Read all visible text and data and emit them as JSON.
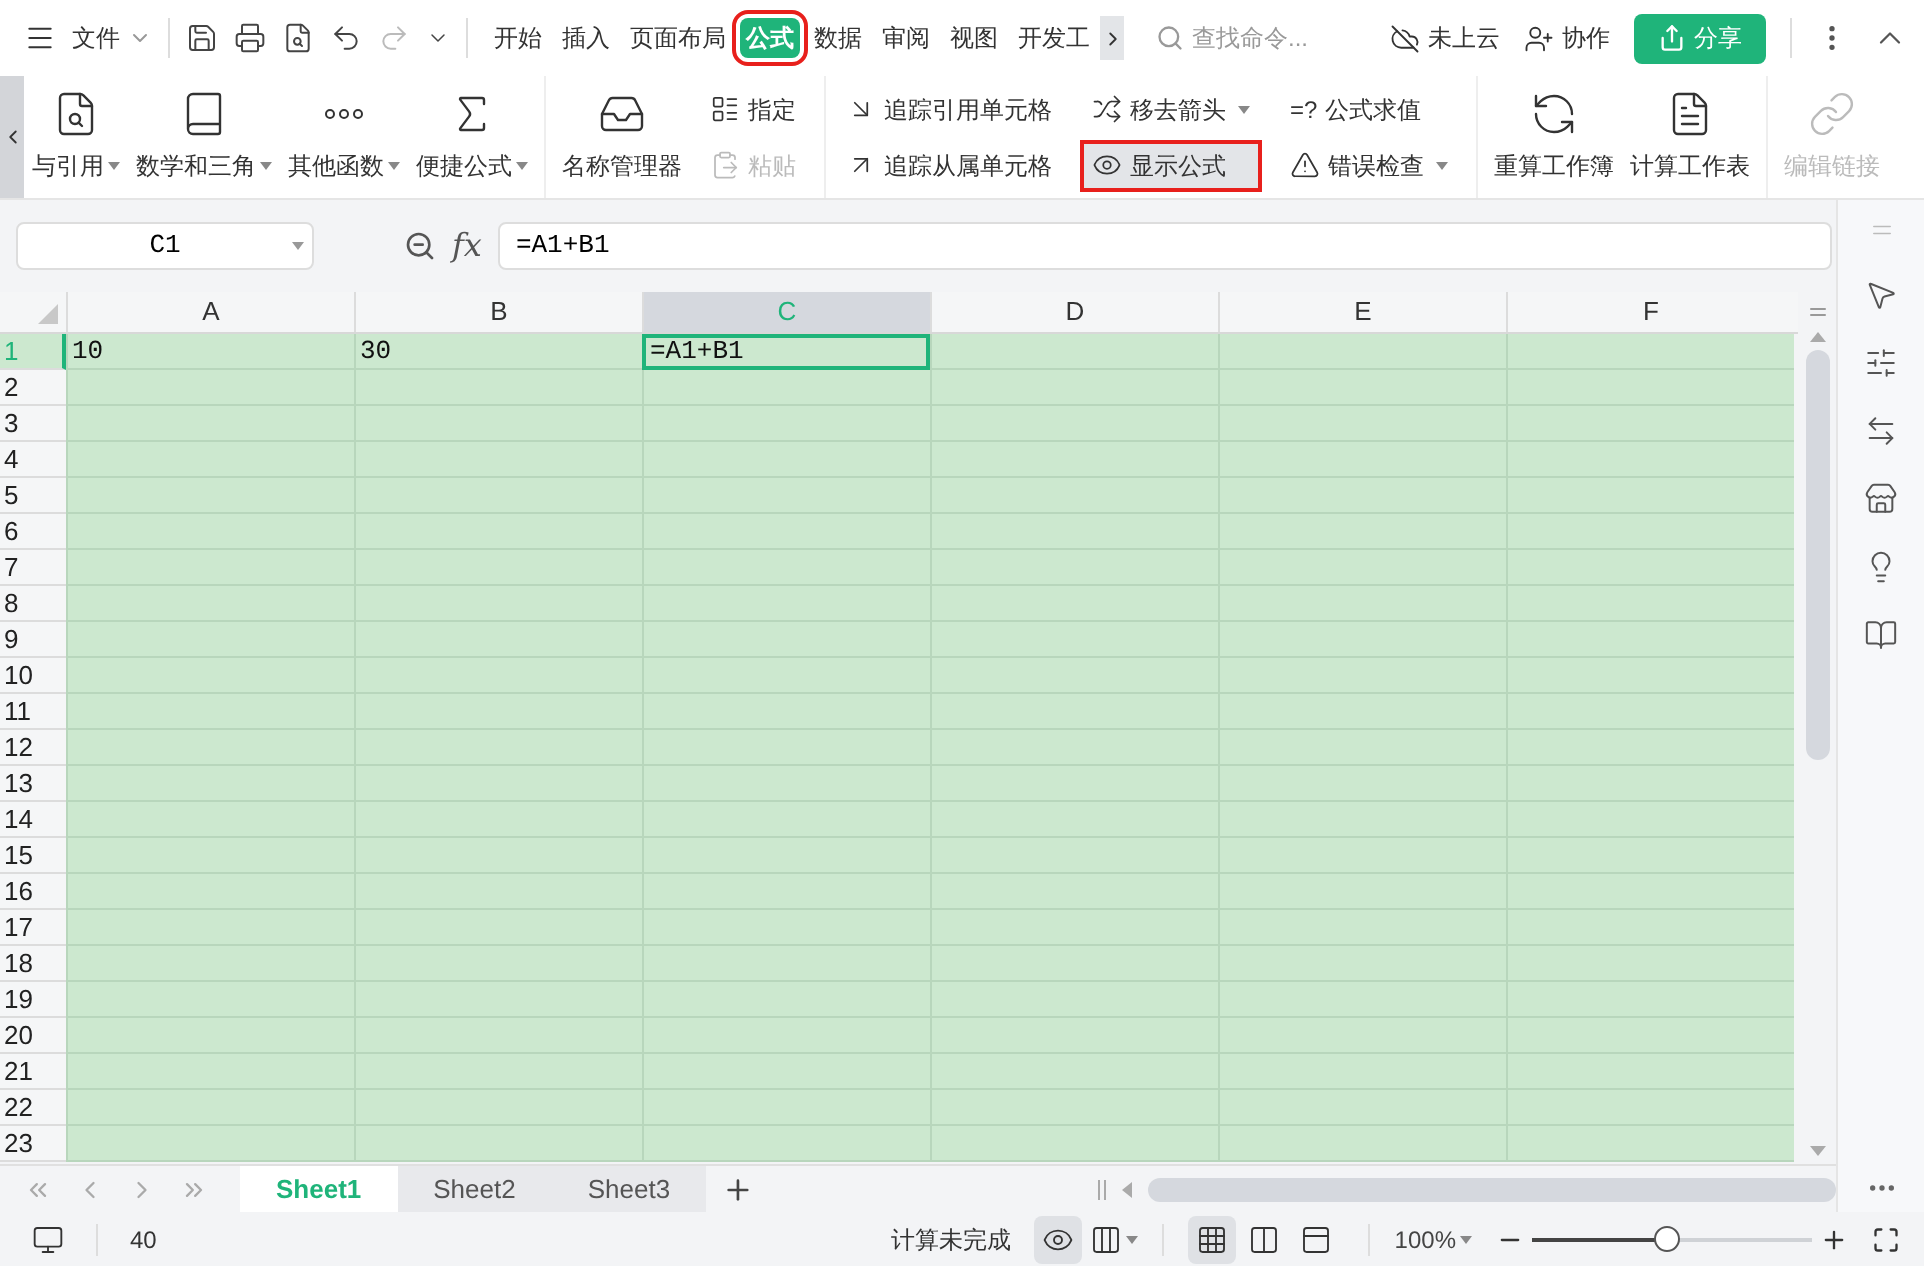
{
  "toolbar": {
    "menu": "文件",
    "tabs": [
      {
        "label": "开始",
        "selected": false,
        "highlighted": false
      },
      {
        "label": "插入",
        "selected": false,
        "highlighted": false
      },
      {
        "label": "页面布局",
        "selected": false,
        "highlighted": false
      },
      {
        "label": "公式",
        "selected": true,
        "highlighted": true
      },
      {
        "label": "数据",
        "selected": false,
        "highlighted": false
      },
      {
        "label": "审阅",
        "selected": false,
        "highlighted": false
      },
      {
        "label": "视图",
        "selected": false,
        "highlighted": false
      },
      {
        "label": "开发工",
        "selected": false,
        "highlighted": false
      }
    ],
    "search": {
      "placeholder": "查找命令..."
    },
    "cloud": "未上云",
    "collab": "协作",
    "share": "分享"
  },
  "ribbon": {
    "groups": [
      {
        "kind": "large",
        "items": [
          {
            "label": "与引用",
            "dropdown": true,
            "disabled": false
          },
          {
            "label": "数学和三角",
            "dropdown": true,
            "disabled": false
          },
          {
            "label": "其他函数",
            "dropdown": true,
            "disabled": false
          },
          {
            "label": "便捷公式",
            "dropdown": true,
            "disabled": false
          }
        ]
      },
      {
        "kind": "large",
        "items": [
          {
            "label": "名称管理器",
            "dropdown": false,
            "disabled": false
          }
        ]
      },
      {
        "kind": "small",
        "items": [
          {
            "label": "指定",
            "dropdown": false,
            "disabled": false,
            "selected": false,
            "highlighted": false
          },
          {
            "label": "粘贴",
            "dropdown": false,
            "disabled": true,
            "selected": false,
            "highlighted": false
          }
        ]
      },
      {
        "kind": "small",
        "items": [
          {
            "label": "追踪引用单元格",
            "dropdown": false,
            "disabled": false,
            "selected": false,
            "highlighted": false
          },
          {
            "label": "追踪从属单元格",
            "dropdown": false,
            "disabled": false,
            "selected": false,
            "highlighted": false
          }
        ]
      },
      {
        "kind": "small",
        "items": [
          {
            "label": "移去箭头",
            "dropdown": true,
            "disabled": false,
            "selected": false,
            "highlighted": false
          },
          {
            "label": "显示公式",
            "dropdown": false,
            "disabled": false,
            "selected": true,
            "highlighted": true
          }
        ]
      },
      {
        "kind": "small",
        "items": [
          {
            "label": "公式求值",
            "icon_text": "=?",
            "dropdown": false,
            "disabled": false,
            "selected": false,
            "highlighted": false
          },
          {
            "label": "错误检查",
            "dropdown": true,
            "disabled": false,
            "selected": false,
            "highlighted": false
          }
        ]
      },
      {
        "kind": "large",
        "items": [
          {
            "label": "重算工作簿",
            "dropdown": false,
            "disabled": false
          },
          {
            "label": "计算工作表",
            "dropdown": false,
            "disabled": false
          }
        ]
      },
      {
        "kind": "large",
        "items": [
          {
            "label": "编辑链接",
            "dropdown": false,
            "disabled": true
          }
        ]
      }
    ]
  },
  "formula_bar": {
    "name_box": "C1",
    "fx_label": "fx",
    "formula": "=A1+B1"
  },
  "sheet": {
    "columns": [
      {
        "label": "A",
        "selected": false
      },
      {
        "label": "B",
        "selected": false
      },
      {
        "label": "C",
        "selected": true
      },
      {
        "label": "D",
        "selected": false
      },
      {
        "label": "E",
        "selected": false
      },
      {
        "label": "F",
        "selected": false
      }
    ],
    "rows": [
      {
        "label": "1",
        "selected": true,
        "cells": [
          {
            "text": "10",
            "selected": false
          },
          {
            "text": "30",
            "selected": false
          },
          {
            "text": "=A1+B1",
            "selected": true
          }
        ]
      },
      {
        "label": "2",
        "selected": false
      },
      {
        "label": "3",
        "selected": false
      },
      {
        "label": "4",
        "selected": false
      },
      {
        "label": "5",
        "selected": false
      },
      {
        "label": "6",
        "selected": false
      },
      {
        "label": "7",
        "selected": false
      },
      {
        "label": "8",
        "selected": false
      },
      {
        "label": "9",
        "selected": false
      },
      {
        "label": "10",
        "selected": false
      },
      {
        "label": "11",
        "selected": false
      },
      {
        "label": "12",
        "selected": false
      },
      {
        "label": "13",
        "selected": false
      },
      {
        "label": "14",
        "selected": false
      },
      {
        "label": "15",
        "selected": false
      },
      {
        "label": "16",
        "selected": false
      },
      {
        "label": "17",
        "selected": false
      },
      {
        "label": "18",
        "selected": false
      },
      {
        "label": "19",
        "selected": false
      },
      {
        "label": "20",
        "selected": false
      },
      {
        "label": "21",
        "selected": false
      },
      {
        "label": "22",
        "selected": false
      },
      {
        "label": "23",
        "selected": false
      }
    ]
  },
  "sheet_tabs": [
    {
      "label": "Sheet1",
      "selected": true
    },
    {
      "label": "Sheet2",
      "selected": false
    },
    {
      "label": "Sheet3",
      "selected": false
    }
  ],
  "status_bar": {
    "value": "40",
    "calc_status": "计算未完成",
    "eye_on": true,
    "view_buttons": [
      {
        "kind": "normal",
        "selected": true
      },
      {
        "kind": "page_break",
        "selected": false
      },
      {
        "kind": "reading",
        "selected": false
      }
    ],
    "zoom": "100%",
    "zoom_slider": {
      "level": 0.48
    }
  }
}
